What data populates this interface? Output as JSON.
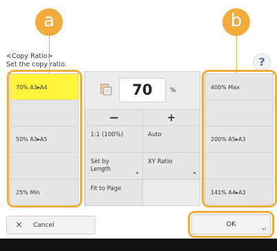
{
  "callouts": {
    "left": "a",
    "right": "b"
  },
  "instruction": {
    "title": "<Copy Ratio>",
    "text": "Set the copy ratio."
  },
  "help": {
    "label": "?"
  },
  "left_presets": [
    {
      "label": "70% A3▸A4",
      "selected": true
    },
    {
      "label": ""
    },
    {
      "label": "50% A3▸A5"
    },
    {
      "label": ""
    },
    {
      "label": "25% Min"
    }
  ],
  "right_presets": [
    {
      "label": "400% Max"
    },
    {
      "label": ""
    },
    {
      "label": "200% A5▸A3"
    },
    {
      "label": ""
    },
    {
      "label": "141% A4▸A3"
    }
  ],
  "ratio": {
    "value": "70",
    "unit": "%"
  },
  "buttons": {
    "minus": "−",
    "plus": "+",
    "one_to_one": "1:1 (100%)",
    "auto": "Auto",
    "set_by_length_line1": "Set by",
    "set_by_length_line2": "Length",
    "xy_ratio": "XY Ratio",
    "fit_to_page": "Fit to Page",
    "cancel": "Cancel",
    "cancel_icon": "×",
    "ok": "OK"
  },
  "colors": {
    "accent_orange": "#f1ab3a",
    "selected_yellow": "#fff33b",
    "panel_gray": "#e6e6e6",
    "footer_black": "#111111"
  },
  "icons": [
    "tools-icon",
    "help-icon",
    "close-icon",
    "submenu-arrow-icon",
    "enter-corner-icon"
  ]
}
